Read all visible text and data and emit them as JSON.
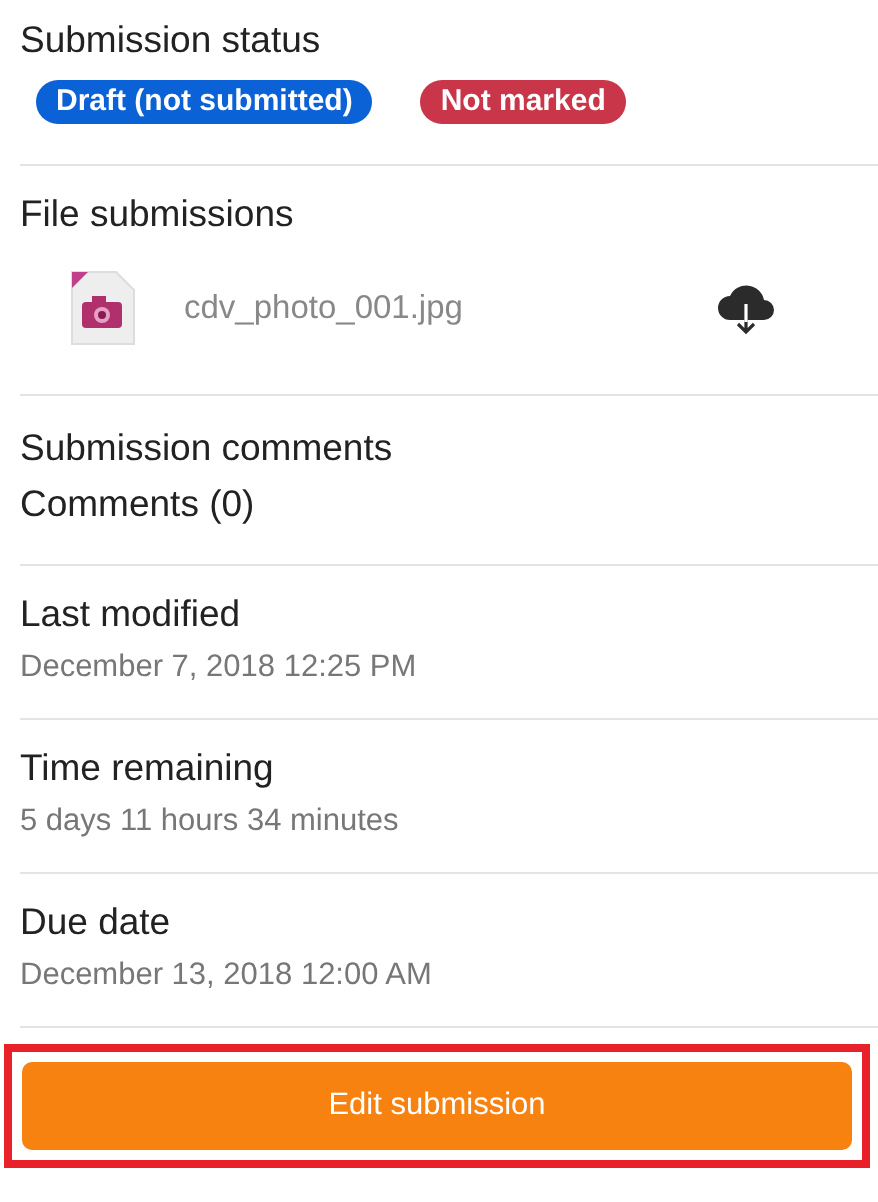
{
  "submission_status": {
    "title": "Submission status",
    "badges": [
      {
        "label": "Draft (not submitted)",
        "color": "#0b62d6"
      },
      {
        "label": "Not marked",
        "color": "#c9364a"
      }
    ]
  },
  "file_submissions": {
    "title": "File submissions",
    "files": [
      {
        "name": "cdv_photo_001.jpg"
      }
    ]
  },
  "fields": [
    {
      "kind": "plain",
      "label": "Submission comments",
      "value": "Comments (0)"
    },
    {
      "kind": "muted",
      "label": "Last modified",
      "value": "December 7, 2018 12:25 PM"
    },
    {
      "kind": "muted",
      "label": "Time remaining",
      "value": "5 days 11 hours 34 minutes"
    },
    {
      "kind": "muted",
      "label": "Due date",
      "value": "December 13, 2018 12:00 AM"
    }
  ],
  "action": {
    "label": "Edit submission",
    "highlighted": true
  }
}
